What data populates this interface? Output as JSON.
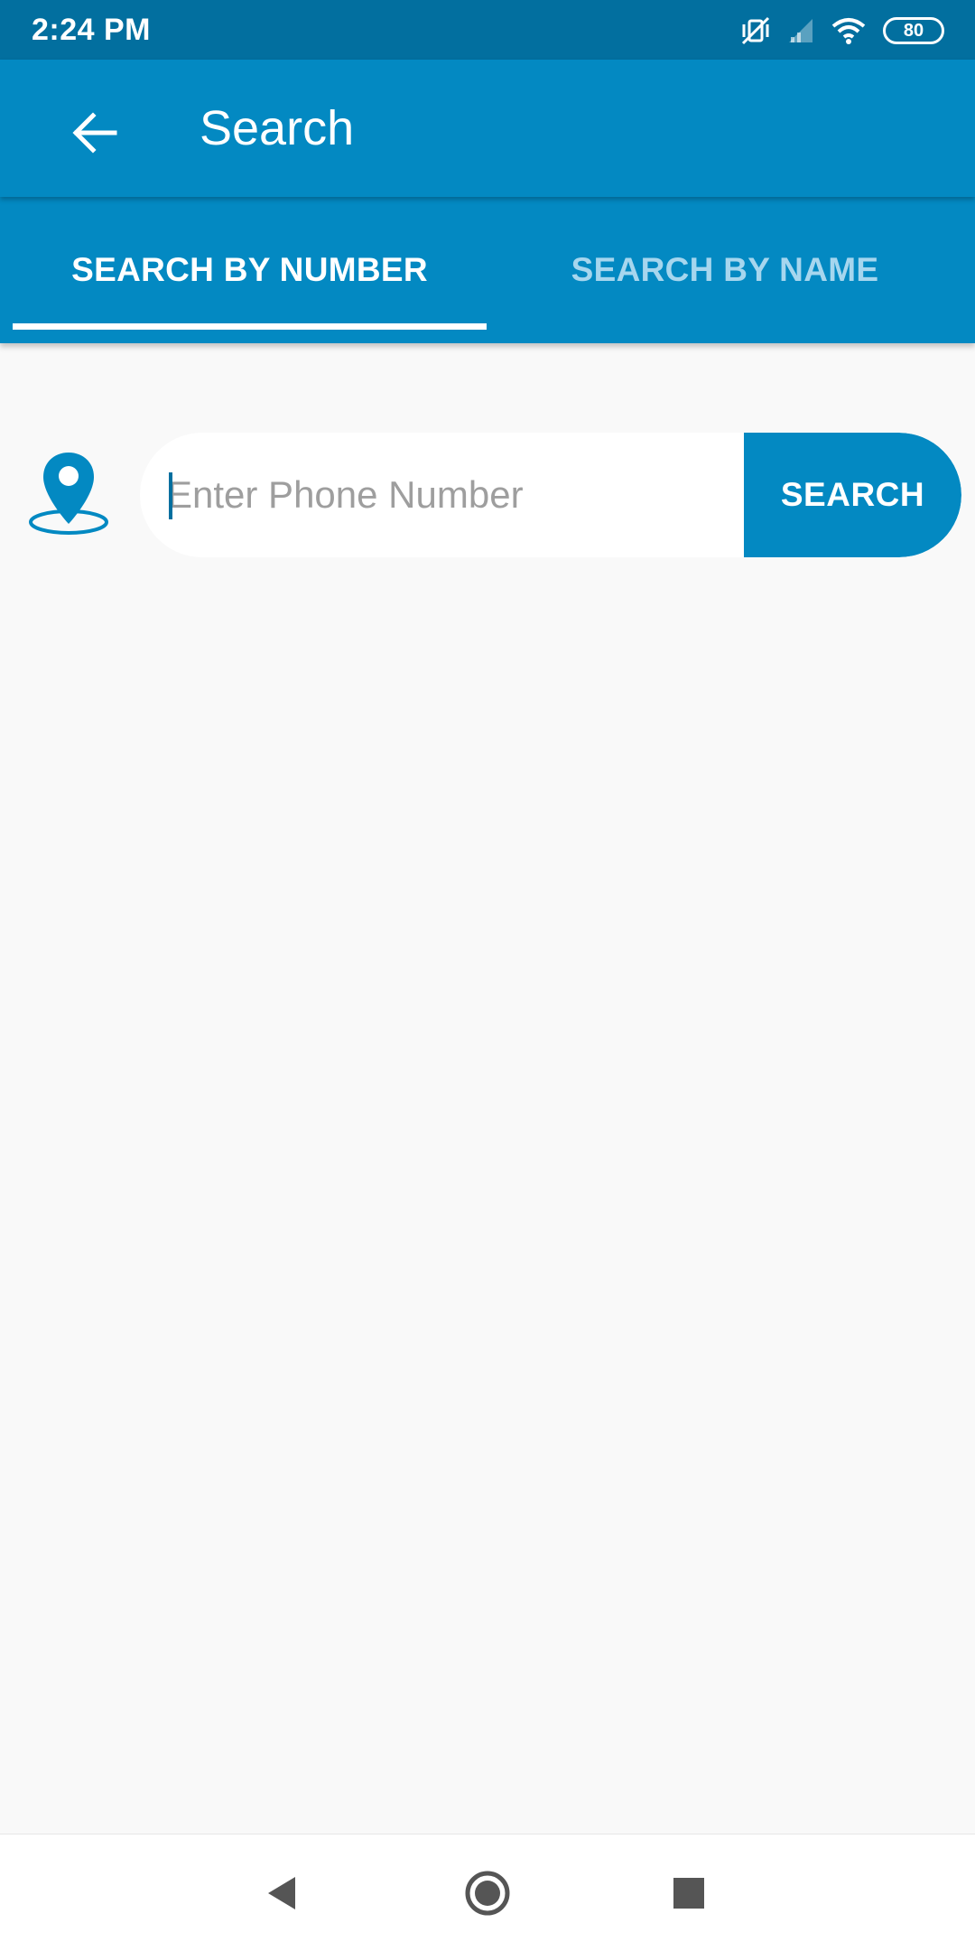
{
  "status_bar": {
    "time": "2:24 PM",
    "battery": "80",
    "icons": [
      "vibrate-off-icon",
      "signal-icon",
      "wifi-icon",
      "battery-icon"
    ]
  },
  "app_bar": {
    "title": "Search",
    "back_icon": "arrow-left-icon"
  },
  "tabs": [
    {
      "label": "SEARCH BY NUMBER",
      "selected": true
    },
    {
      "label": "SEARCH BY NAME",
      "selected": false
    }
  ],
  "search": {
    "placeholder": "Enter Phone Number",
    "value": "",
    "button_label": "SEARCH",
    "location_icon": "map-pin-icon"
  },
  "nav_bar": {
    "icons": [
      "nav-back-icon",
      "nav-home-icon",
      "nav-recents-icon"
    ]
  },
  "colors": {
    "status_bar": "#026f9f",
    "primary": "#0389c2",
    "tab_inactive": "#a6d6ee",
    "background": "#f9f9f9"
  }
}
